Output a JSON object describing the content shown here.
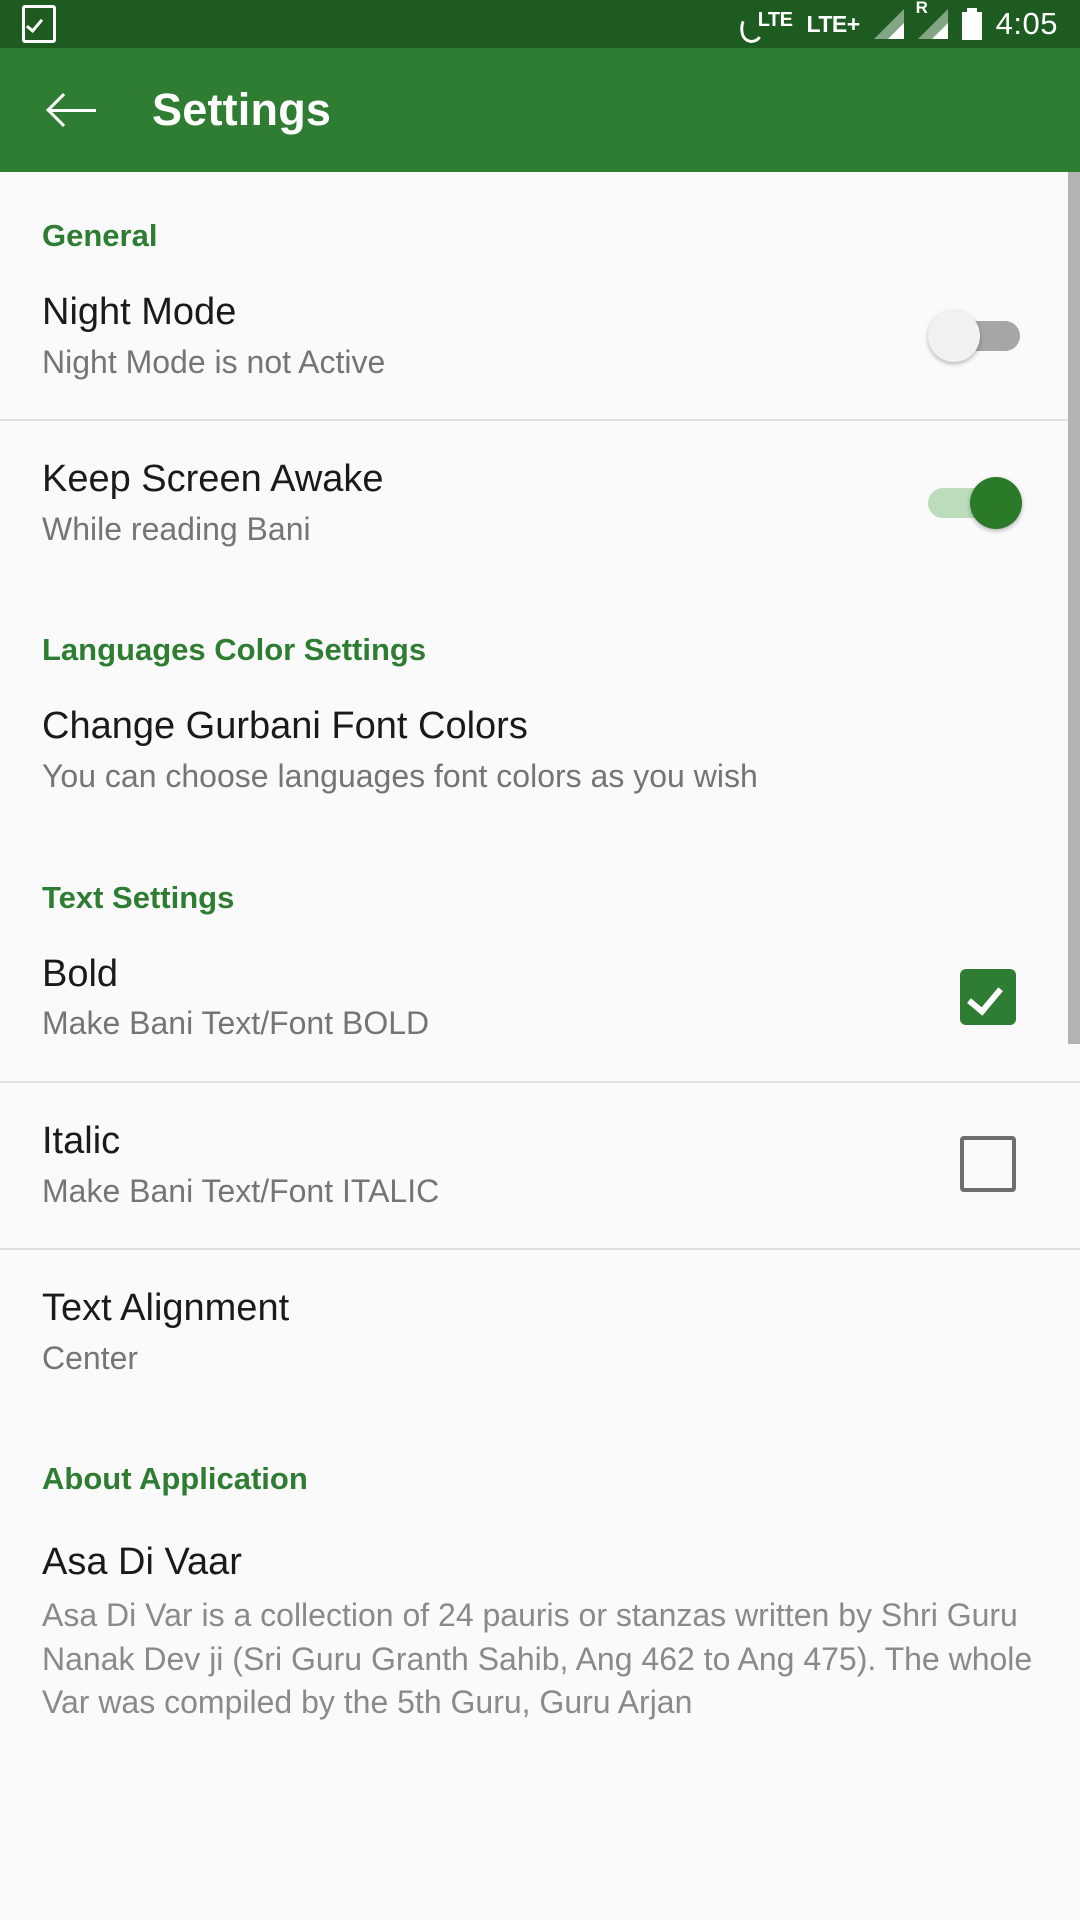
{
  "status_bar": {
    "task_icon": "checkbox-task-icon",
    "call_lte_label": "LTE",
    "network_label": "LTE+",
    "roaming_label": "R",
    "battery_icon": "battery-icon",
    "time": "4:05"
  },
  "app_bar": {
    "back_icon": "back-arrow-icon",
    "title": "Settings"
  },
  "colors": {
    "status_bar_bg": "#1d5b20",
    "app_bar_bg": "#2e7d32",
    "accent_green": "#2e7d32",
    "toggle_on_thumb": "#2a7a2a",
    "toggle_on_track": "#bcdcbc",
    "toggle_off_track": "#a6a6a6",
    "content_bg": "#fafafa",
    "divider": "#e0e0e0",
    "primary_text": "#1a1a1a",
    "secondary_text": "#757575",
    "scrollbar": "#b3b3b3"
  },
  "sections": {
    "general": {
      "heading": "General",
      "rows": [
        {
          "title": "Night Mode",
          "subtitle": "Night Mode is not Active",
          "control": "switch",
          "state": "off"
        },
        {
          "title": "Keep Screen Awake",
          "subtitle": "While reading Bani",
          "control": "switch",
          "state": "on"
        }
      ]
    },
    "languages": {
      "heading": "Languages Color Settings",
      "rows": [
        {
          "title": "Change Gurbani Font Colors",
          "subtitle": "You can choose languages font colors as you wish",
          "control": "none",
          "state": ""
        }
      ]
    },
    "text_settings": {
      "heading": "Text Settings",
      "rows": [
        {
          "title": "Bold",
          "subtitle": "Make Bani Text/Font BOLD",
          "control": "checkbox",
          "state": "checked"
        },
        {
          "title": "Italic",
          "subtitle": "Make Bani Text/Font ITALIC",
          "control": "checkbox",
          "state": "unchecked"
        },
        {
          "title": "Text Alignment",
          "subtitle": "Center",
          "control": "none",
          "state": ""
        }
      ]
    },
    "about": {
      "heading": "About Application",
      "app_name": "Asa Di Vaar",
      "description": "Asa Di Var is a collection of 24 pauris or stanzas written by Shri Guru Nanak Dev ji (Sri Guru Granth Sahib, Ang 462 to Ang 475). The whole Var was compiled by the 5th Guru, Guru Arjan"
    }
  }
}
